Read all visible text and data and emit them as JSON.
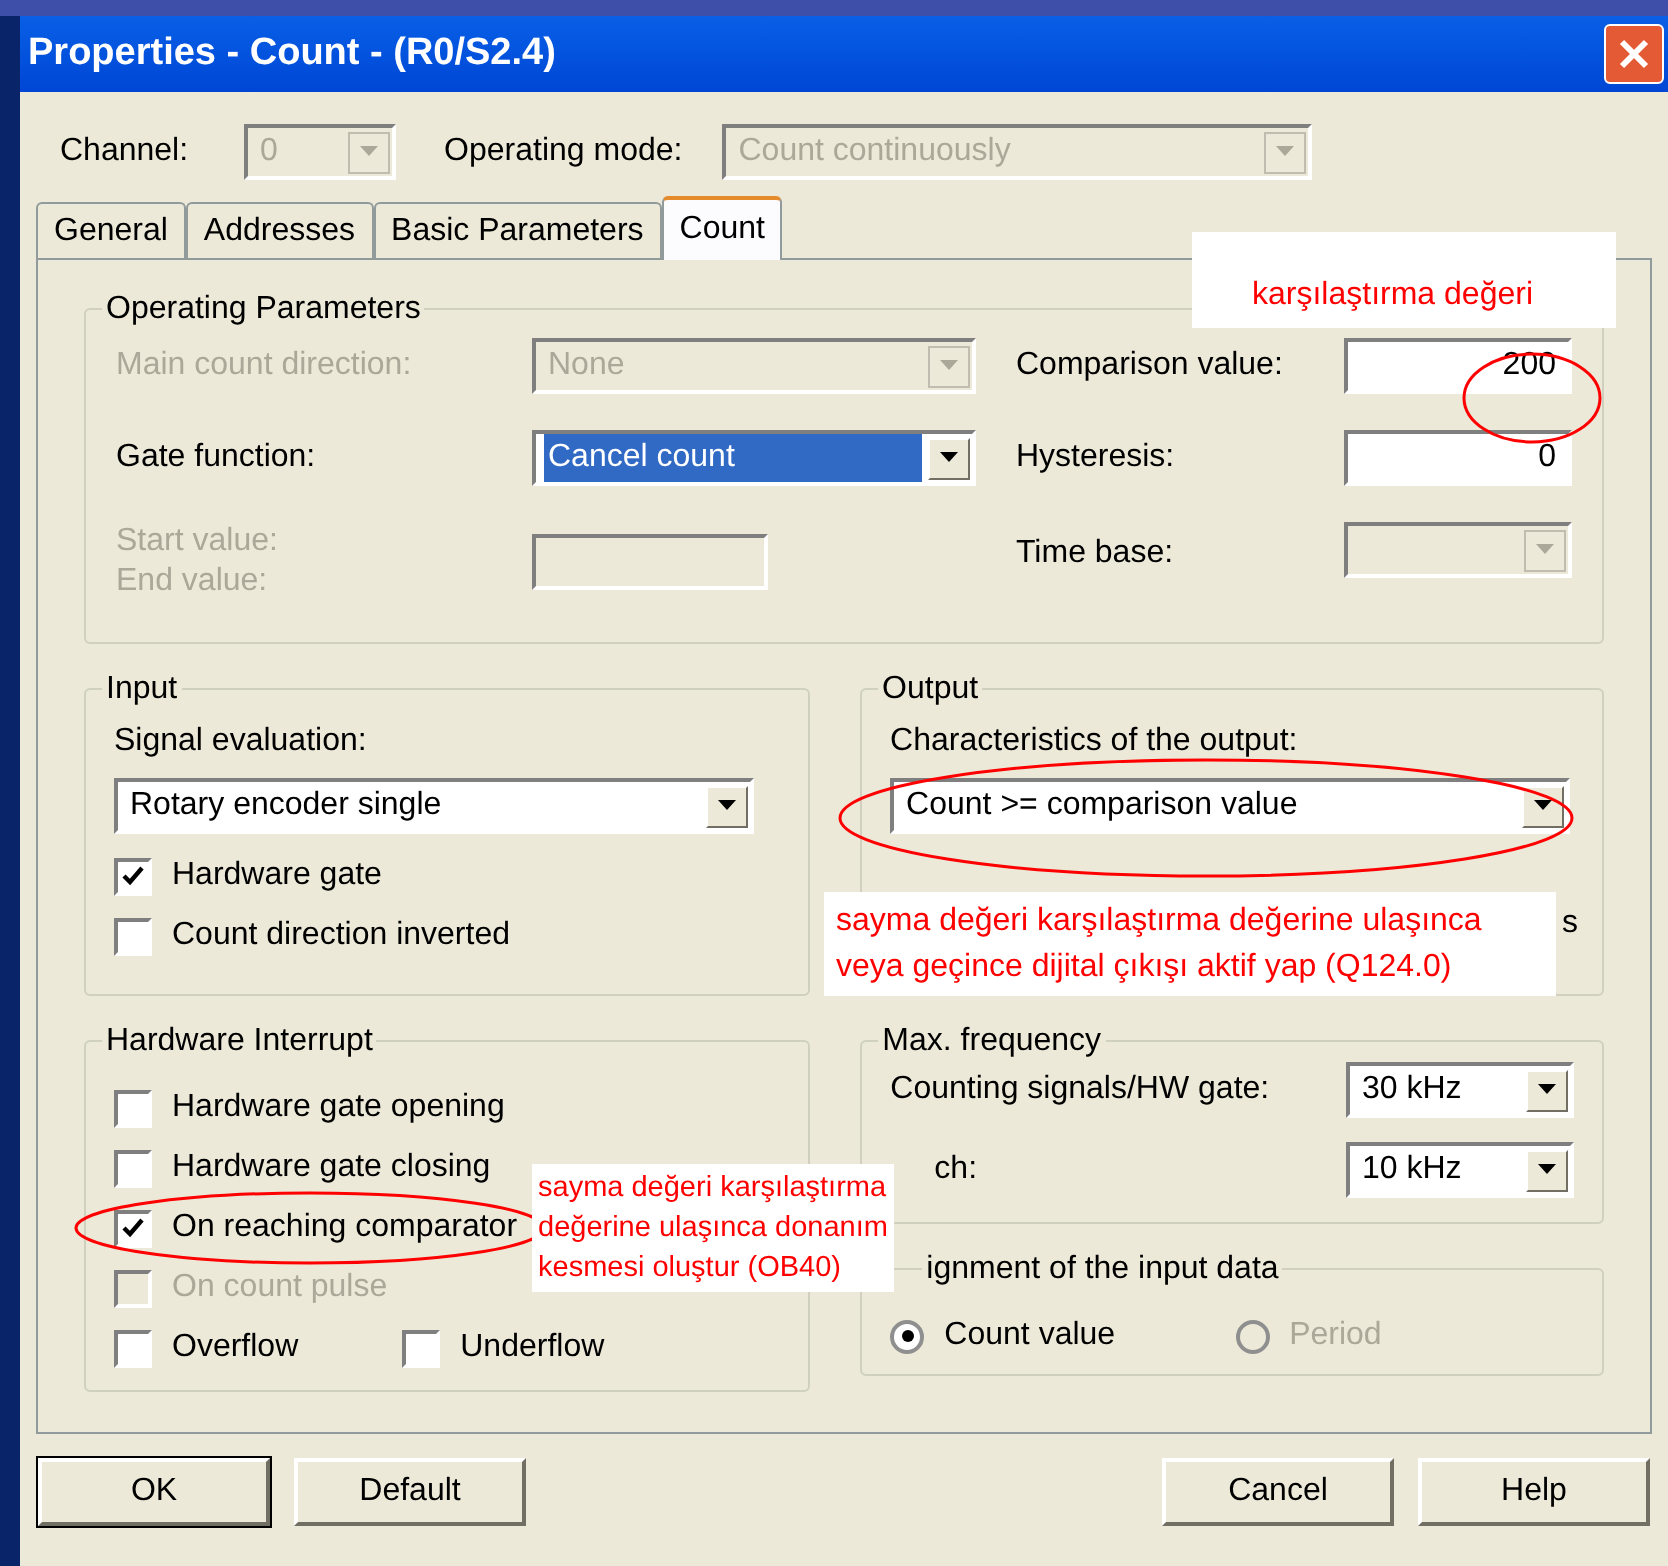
{
  "window": {
    "title": "Properties - Count - (R0/S2.4)"
  },
  "top": [
    {
      "label": "Channel:",
      "value": "0",
      "disabled": true
    },
    {
      "label": "Operating mode:",
      "value": "Count continuously",
      "disabled": true
    }
  ],
  "tabs": [
    {
      "label": "General",
      "selected": false
    },
    {
      "label": "Addresses",
      "selected": false
    },
    {
      "label": "Basic Parameters",
      "selected": false
    },
    {
      "label": "Count",
      "selected": true
    }
  ],
  "operating_parameters": {
    "title": "Operating Parameters",
    "left": [
      {
        "kind": "combo",
        "label": "Main count direction:",
        "value": "None",
        "disabled": true,
        "highlighted": false
      },
      {
        "kind": "combo",
        "label": "Gate function:",
        "value": "Cancel count",
        "disabled": false,
        "highlighted": true
      },
      {
        "kind": "input",
        "label": "Start value:",
        "label2": "End value:",
        "disabled": true
      }
    ],
    "right": [
      {
        "kind": "input",
        "label": "Comparison value:",
        "value": "200",
        "disabled": false
      },
      {
        "kind": "input",
        "label": "Hysteresis:",
        "value": "0",
        "disabled": false
      },
      {
        "kind": "combo",
        "label": "Time base:",
        "disabled": true
      }
    ]
  },
  "input": {
    "title": "Input",
    "signal_label": "Signal evaluation:",
    "signal_value": "Rotary encoder single",
    "checks": [
      {
        "label": "Hardware gate",
        "checked": true,
        "disabled": false
      },
      {
        "label": "Count direction inverted",
        "checked": false,
        "disabled": false
      }
    ]
  },
  "output": {
    "title": "Output",
    "characteristics_label": "Characteristics of the output:",
    "characteristics_value": "Count >= comparison value",
    "hidden_label_tail": "s"
  },
  "hardware_interrupt": {
    "title": "Hardware Interrupt",
    "checks": [
      {
        "label": "Hardware gate opening",
        "checked": false,
        "disabled": false
      },
      {
        "label": "Hardware gate closing",
        "checked": false,
        "disabled": false
      },
      {
        "label": "On reaching comparator",
        "checked": true,
        "disabled": false
      },
      {
        "label": "On count pulse",
        "checked": false,
        "disabled": true
      }
    ],
    "bottom_checks": [
      {
        "label": "Overflow",
        "checked": false,
        "disabled": false
      },
      {
        "label": "Underflow",
        "checked": false,
        "disabled": false
      }
    ]
  },
  "max_frequency": {
    "title": "Max. frequency",
    "rows": [
      {
        "label": "Counting signals/HW gate:",
        "value": "30 kHz"
      },
      {
        "label": "ch:",
        "value": "10 kHz"
      }
    ]
  },
  "assignment": {
    "title": "ignment of the input data",
    "options": [
      {
        "label": "Count value",
        "selected": true,
        "disabled": false
      },
      {
        "label": "Period",
        "selected": false,
        "disabled": true
      }
    ]
  },
  "buttons": [
    {
      "label": "OK",
      "default": true
    },
    {
      "label": "Default",
      "default": false
    },
    {
      "label": "Cancel",
      "default": false
    },
    {
      "label": "Help",
      "default": false
    }
  ],
  "annotations": [
    {
      "lines": [
        "karşılaştırma değeri"
      ]
    },
    {
      "lines": [
        "sayma değeri karşılaştırma değerine ulaşınca",
        "veya geçince dijital çıkışı aktif yap (Q124.0)"
      ]
    },
    {
      "lines": [
        "sayma değeri karşılaştırma",
        "değerine ulaşınca donanım",
        "kesmesi oluştur (OB40)"
      ]
    }
  ]
}
